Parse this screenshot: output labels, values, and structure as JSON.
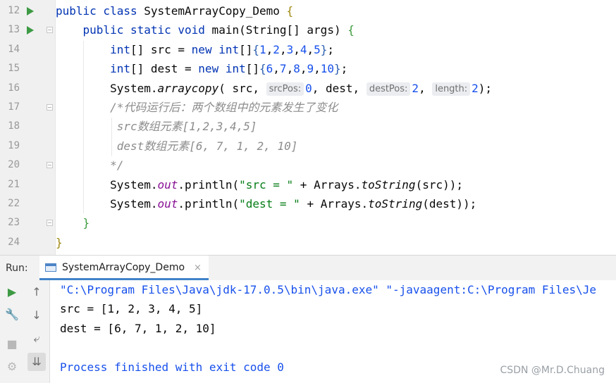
{
  "editor": {
    "lines": [
      {
        "n": "12",
        "text": "public class SystemArrayCopy_Demo {"
      },
      {
        "n": "13",
        "text": "    public static void main(String[] args) {"
      },
      {
        "n": "14",
        "text": "        int[] src = new int[]{1,2,3,4,5};"
      },
      {
        "n": "15",
        "text": "        int[] dest = new int[]{6,7,8,9,10};"
      },
      {
        "n": "16",
        "text": "        System.arraycopy( src,  srcPos: 0, dest,  destPos: 2,  length: 2);"
      },
      {
        "n": "17",
        "text": "        /*代码运行后：两个数组中的元素发生了变化"
      },
      {
        "n": "18",
        "text": "         src数组元素[1,2,3,4,5]"
      },
      {
        "n": "19",
        "text": "         dest数组元素[6, 7, 1, 2, 10]"
      },
      {
        "n": "20",
        "text": "        */"
      },
      {
        "n": "21",
        "text": "        System.out.println(\"src = \" + Arrays.toString(src));"
      },
      {
        "n": "22",
        "text": "        System.out.println(\"dest = \" + Arrays.toString(dest));"
      },
      {
        "n": "23",
        "text": "    }"
      },
      {
        "n": "24",
        "text": "}"
      }
    ],
    "hints": {
      "src_pos": "srcPos:",
      "dest_pos": "destPos:",
      "length": "length:"
    },
    "colors": {
      "keyword": "#0033b3",
      "number": "#1750eb",
      "string": "#067d17",
      "static_field": "#871094",
      "comment": "#8c8c8c",
      "run_gutter": "#3d9a44"
    }
  },
  "run_window": {
    "label": "Run:",
    "tab_title": "SystemArrayCopy_Demo",
    "tab_close": "×",
    "tools": {
      "rerun": "▶",
      "settings": "🔧",
      "stop": "■",
      "debug": "⚙",
      "up": "↑",
      "down": "↓",
      "wrap": "⤶",
      "scroll_end": "⇊"
    }
  },
  "console": {
    "command": "\"C:\\Program Files\\Java\\jdk-17.0.5\\bin\\java.exe\" \"-javaagent:C:\\Program Files\\Je",
    "output": [
      "src = [1, 2, 3, 4, 5]",
      "dest = [6, 7, 1, 2, 10]"
    ],
    "exit": "Process finished with exit code 0"
  },
  "watermark": "CSDN @Mr.D.Chuang"
}
